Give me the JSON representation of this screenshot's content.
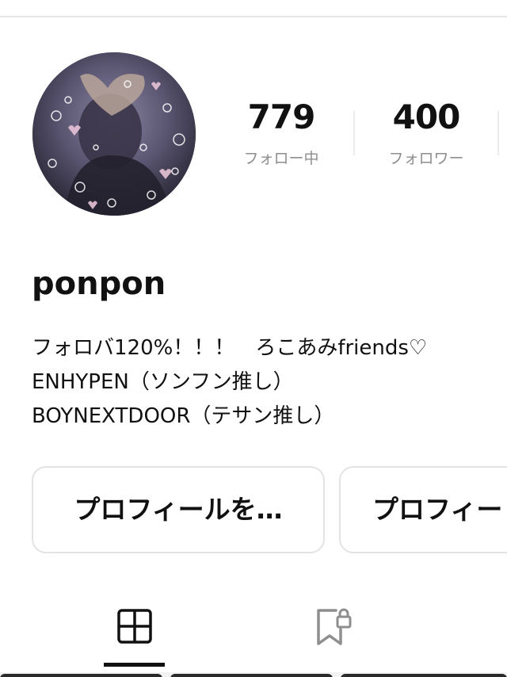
{
  "profile": {
    "username": "ponpon",
    "bio_lines": [
      "フォロバ120%！！！　ろこあみfriends♡",
      "ENHYPEN（ソンフン推し）",
      "BOYNEXTDOOR（テサン推し）"
    ]
  },
  "stats": {
    "following": {
      "value": "779",
      "label": "フォロー中"
    },
    "followers": {
      "value": "400",
      "label": "フォロワー"
    }
  },
  "actions": {
    "edit_profile_label": "プロフィールを…",
    "share_profile_label": "プロフィー"
  },
  "tabs": [
    {
      "icon": "grid-icon",
      "active": true
    },
    {
      "icon": "bookmark-lock-icon",
      "active": false
    }
  ]
}
